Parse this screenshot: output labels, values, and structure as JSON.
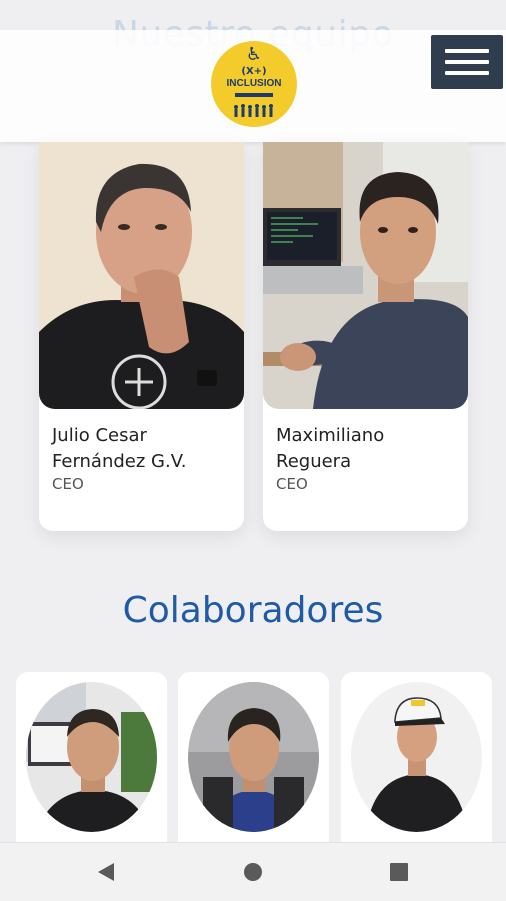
{
  "header": {
    "faded_title": "Nuestro equipo",
    "logo": {
      "icon": "wheelchair-icon",
      "line1": "(X+)",
      "line2": "INCLUSION"
    },
    "menu_icon": "hamburger-menu-icon"
  },
  "team": [
    {
      "name": "Julio Cesar Fernández G.V.",
      "role": "CEO"
    },
    {
      "name": "Maximiliano Reguera",
      "role": "CEO"
    }
  ],
  "collaborators": {
    "title": "Colaboradores",
    "count_visible": 3
  },
  "navbar": {
    "back_icon": "back-triangle-icon",
    "home_icon": "home-circle-icon",
    "recents_icon": "recents-square-icon"
  },
  "colors": {
    "title_blue": "#1f5aa6",
    "menu_bg": "#2f3d4f",
    "logo_yellow": "#f3cc2c",
    "page_bg": "#efeff1"
  }
}
